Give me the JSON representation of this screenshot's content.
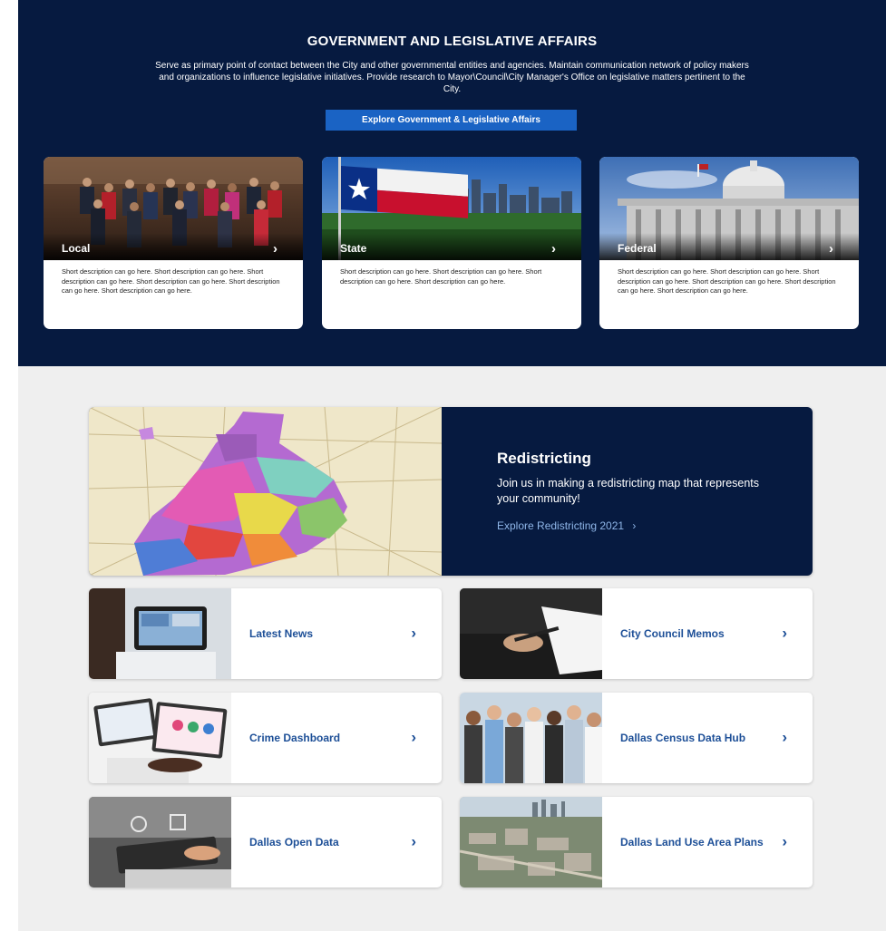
{
  "hero": {
    "title": "GOVERNMENT AND LEGISLATIVE AFFAIRS",
    "description": "Serve as primary point of contact between the City and other governmental entities and agencies. Maintain communication network of policy makers and organizations to influence legislative initiatives. Provide research to Mayor\\Council\\City Manager's Office on legislative matters pertinent to the City.",
    "button_label": "Explore Government & Legislative Affairs",
    "cards": [
      {
        "label": "Local",
        "description": "Short description can go here. Short description can go here. Short description can go here. Short description can go here. Short description can go here. Short description can go here."
      },
      {
        "label": "State",
        "description": "Short description can go here. Short description can go here. Short description can go here. Short description can go here."
      },
      {
        "label": "Federal",
        "description": "Short description can go here. Short description can go here. Short description can go here. Short description can go here. Short description can go here. Short description can go here."
      }
    ]
  },
  "redistricting": {
    "title": "Redistricting",
    "description": "Join us in making a redistricting map that represents your community!",
    "link_label": "Explore Redistricting 2021"
  },
  "tiles": [
    {
      "label": "Latest News"
    },
    {
      "label": "City Council Memos"
    },
    {
      "label": "Crime Dashboard"
    },
    {
      "label": "Dallas Census Data Hub"
    },
    {
      "label": "Dallas Open Data"
    },
    {
      "label": "Dallas Land Use Area Plans"
    }
  ],
  "icons": {
    "chevron": "›"
  },
  "colors": {
    "navy": "#061a40",
    "button_blue": "#1a63c4",
    "link_blue": "#1d4f97",
    "section_gray": "#efefef"
  }
}
